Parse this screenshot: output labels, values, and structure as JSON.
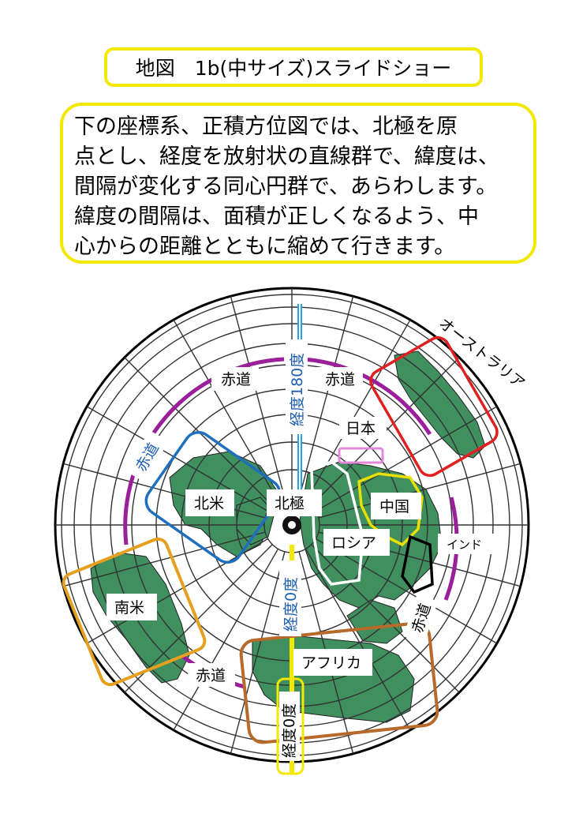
{
  "title": "地図　1b(中サイズ)スライドショー",
  "description": [
    "下の座標系、正積方位図では、北極を原",
    "点とし、経度を放射状の直線群で、緯度は、",
    "間隔が変化する同心円群で、あらわします。",
    "緯度の間隔は、面積が正しくなるよう、中",
    "心からの距離とともに縮めて行きます。"
  ],
  "map": {
    "labels": {
      "australia": "オーストラリア",
      "equator": "赤道",
      "longitude_180": "経度180度",
      "japan": "日本",
      "north_america": "北米",
      "north_pole": "北極",
      "china": "中国",
      "russia": "ロシア",
      "india": "インド",
      "south_america": "南米",
      "longitude_0": "経度0度",
      "africa": "アフリカ"
    },
    "colors": {
      "land": "#3f8f5f",
      "equator_arc": "#9b1f9b",
      "meridian_180": "#29a3e0",
      "north_america_box": "#1f6fbf",
      "south_america_box": "#e6a020",
      "africa_box": "#b86a2a",
      "australia_box": "#e02020",
      "japan_box": "#e08ad8",
      "china_box": "#e8e000",
      "russia_box": "#ffffff",
      "india_box": "#000000",
      "longitude_0_box": "#f2e800"
    }
  }
}
